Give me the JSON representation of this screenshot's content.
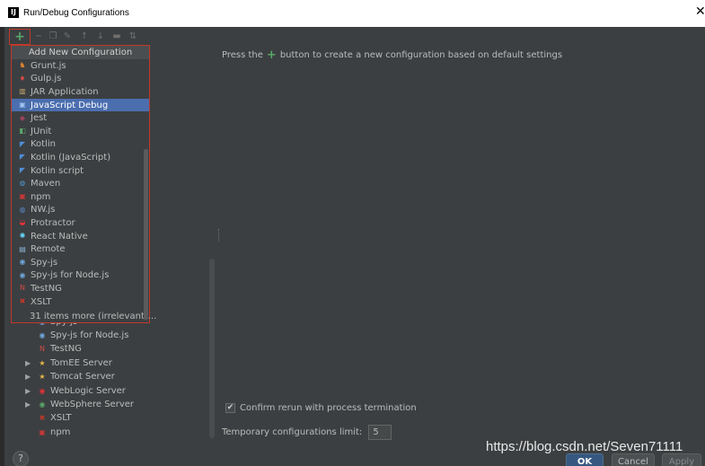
{
  "window": {
    "title": "Run/Debug Configurations",
    "icon_text": "IJ"
  },
  "toolbar": {
    "add_icon": "+",
    "icons": [
      "remove-icon",
      "copy-icon",
      "edit-defaults-icon",
      "move-up-icon",
      "move-down-icon",
      "folder-icon",
      "sort-icon"
    ]
  },
  "popup": {
    "header": "Add New Configuration",
    "items": [
      {
        "label": "Grunt.js",
        "icon": "grunt-icon",
        "color": "#e48632"
      },
      {
        "label": "Gulp.js",
        "icon": "gulp-icon",
        "color": "#d34a47"
      },
      {
        "label": "JAR Application",
        "icon": "jar-icon",
        "color": "#c9a96e"
      },
      {
        "label": "JavaScript Debug",
        "icon": "js-debug-icon",
        "color": "#4b8fd8"
      },
      {
        "label": "Jest",
        "icon": "jest-icon",
        "color": "#99425b"
      },
      {
        "label": "JUnit",
        "icon": "junit-icon",
        "color": "#59a869"
      },
      {
        "label": "Kotlin",
        "icon": "kotlin-icon",
        "color": "#4f8ed8"
      },
      {
        "label": "Kotlin (JavaScript)",
        "icon": "kotlin-js-icon",
        "color": "#4f8ed8"
      },
      {
        "label": "Kotlin script",
        "icon": "kotlin-script-icon",
        "color": "#4f8ed8"
      },
      {
        "label": "Maven",
        "icon": "maven-icon",
        "color": "#4e9dd9"
      },
      {
        "label": "npm",
        "icon": "npm-icon",
        "color": "#cb3837"
      },
      {
        "label": "NW.js",
        "icon": "nwjs-icon",
        "color": "#5a88c6"
      },
      {
        "label": "Protractor",
        "icon": "protractor-icon",
        "color": "#e23237"
      },
      {
        "label": "React Native",
        "icon": "react-icon",
        "color": "#61dafb"
      },
      {
        "label": "Remote",
        "icon": "remote-icon",
        "color": "#8ab4d9"
      },
      {
        "label": "Spy-js",
        "icon": "spyjs-icon",
        "color": "#6fa8dc"
      },
      {
        "label": "Spy-js for Node.js",
        "icon": "spyjs-node-icon",
        "color": "#6fa8dc"
      },
      {
        "label": "TestNG",
        "icon": "testng-icon",
        "color": "#d34a47"
      },
      {
        "label": "XSLT",
        "icon": "xslt-icon",
        "color": "#c0392b"
      }
    ],
    "selected_index": 3,
    "more": "31 items more (irrelevant)..."
  },
  "tree": {
    "items": [
      {
        "label": "Spy-js",
        "icon": "spyjs-icon",
        "color": "#6fa8dc",
        "expandable": false
      },
      {
        "label": "Spy-js for Node.js",
        "icon": "spyjs-node-icon",
        "color": "#6fa8dc",
        "expandable": false
      },
      {
        "label": "TestNG",
        "icon": "testng-icon",
        "color": "#d34a47",
        "expandable": false
      },
      {
        "label": "TomEE Server",
        "icon": "tomee-icon",
        "color": "#e8b849",
        "expandable": true
      },
      {
        "label": "Tomcat Server",
        "icon": "tomcat-icon",
        "color": "#e8b849",
        "expandable": true
      },
      {
        "label": "WebLogic Server",
        "icon": "weblogic-icon",
        "color": "#e23237",
        "expandable": true
      },
      {
        "label": "WebSphere Server",
        "icon": "websphere-icon",
        "color": "#59a869",
        "expandable": true
      },
      {
        "label": "XSLT",
        "icon": "xslt-icon",
        "color": "#c0392b",
        "expandable": false
      },
      {
        "label": "npm",
        "icon": "npm-icon",
        "color": "#cb3837",
        "expandable": false
      }
    ]
  },
  "main": {
    "hint_before": "Press the",
    "hint_after": "button to create a new configuration based on default settings",
    "confirm_label": "Confirm rerun with process termination",
    "confirm_checked": true,
    "limit_label": "Temporary configurations limit:",
    "limit_value": "5"
  },
  "buttons": {
    "ok": "OK",
    "cancel": "Cancel",
    "apply": "Apply",
    "help": "?"
  },
  "watermark": "https://blog.csdn.net/Seven71111",
  "colors": {
    "accent": "#4b6eaf",
    "highlight_border": "#c0392b",
    "add_green": "#59a869"
  }
}
